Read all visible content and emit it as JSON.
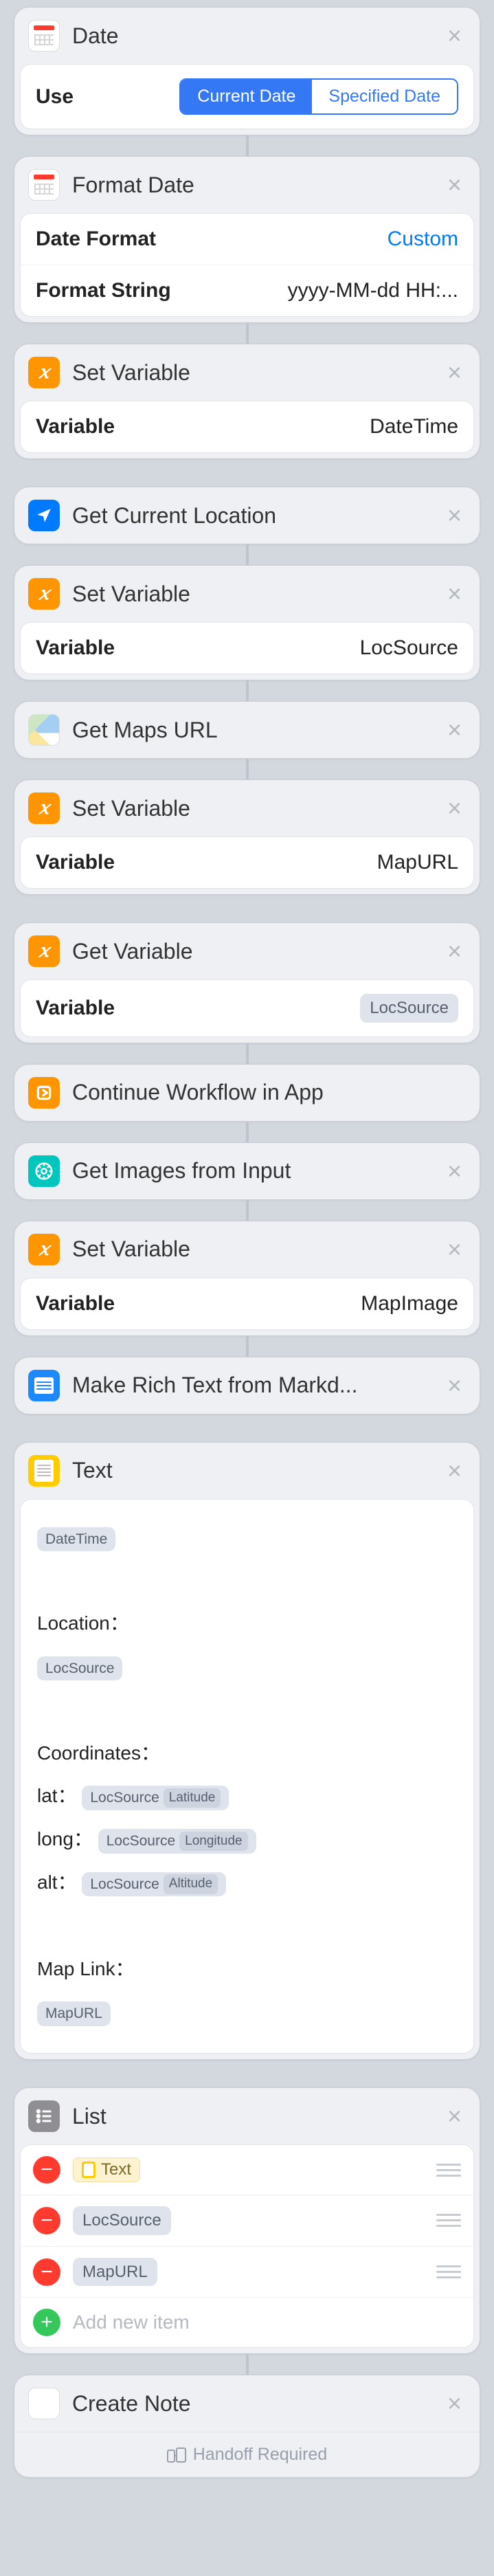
{
  "actions": {
    "date": {
      "title": "Date",
      "use_label": "Use",
      "segments": {
        "current": "Current Date",
        "specified": "Specified Date"
      }
    },
    "format_date": {
      "title": "Format Date",
      "rows": {
        "format_label": "Date Format",
        "format_value": "Custom",
        "string_label": "Format String",
        "string_value": "yyyy-MM-dd HH:..."
      }
    },
    "setvar_datetime": {
      "title": "Set Variable",
      "label": "Variable",
      "value": "DateTime"
    },
    "get_location": {
      "title": "Get Current Location"
    },
    "setvar_locsource": {
      "title": "Set Variable",
      "label": "Variable",
      "value": "LocSource"
    },
    "get_maps_url": {
      "title": "Get Maps URL"
    },
    "setvar_mapurl": {
      "title": "Set Variable",
      "label": "Variable",
      "value": "MapURL"
    },
    "getvar": {
      "title": "Get Variable",
      "label": "Variable",
      "token": "LocSource"
    },
    "continue": {
      "title": "Continue Workflow in App"
    },
    "get_images": {
      "title": "Get Images from Input"
    },
    "setvar_mapimage": {
      "title": "Set Variable",
      "label": "Variable",
      "value": "MapImage"
    },
    "richtext": {
      "title": "Make Rich Text from Markd..."
    },
    "text": {
      "title": "Text",
      "token_datetime": "DateTime",
      "line_location": "Location：",
      "token_loc": "LocSource",
      "line_coords": "Coordinates：",
      "line_lat": "lat：",
      "line_long": "long：",
      "line_alt": "alt：",
      "sub_lat": "Latitude",
      "sub_long": "Longitude",
      "sub_alt": "Altitude",
      "line_maplink": "Map Link：",
      "token_mapurl": "MapURL"
    },
    "list": {
      "title": "List",
      "item_text": "Text",
      "item_loc": "LocSource",
      "item_map": "MapURL",
      "add": "Add new item"
    },
    "create_note": {
      "title": "Create Note",
      "handoff": "Handoff Required"
    }
  }
}
